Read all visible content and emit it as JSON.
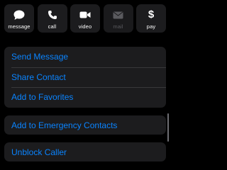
{
  "actions": [
    {
      "label": "message",
      "icon": "message-icon",
      "enabled": true
    },
    {
      "label": "call",
      "icon": "phone-icon",
      "enabled": true
    },
    {
      "label": "video",
      "icon": "video-icon",
      "enabled": true
    },
    {
      "label": "mail",
      "icon": "mail-icon",
      "enabled": false
    },
    {
      "label": "pay",
      "icon": "dollar-icon",
      "enabled": true
    }
  ],
  "pay_symbol": "$",
  "options": {
    "send_message": "Send Message",
    "share_contact": "Share Contact",
    "add_to_favorites": "Add to Favorites",
    "add_to_emergency": "Add to Emergency Contacts",
    "unblock_caller": "Unblock Caller"
  },
  "colors": {
    "accent": "#0a84ff",
    "background": "#000000",
    "cell": "#1c1c1e",
    "disabled": "#5a5a5e"
  }
}
